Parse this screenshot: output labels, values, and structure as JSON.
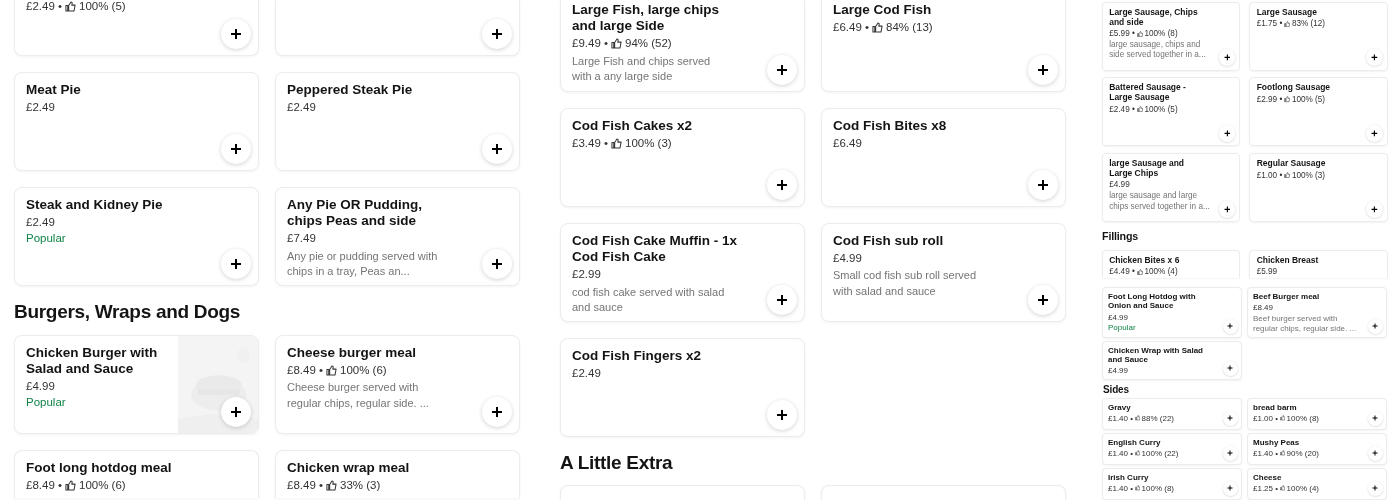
{
  "panels": [
    {
      "blocks": [
        {
          "kind": "cards",
          "items": [
            {
              "kind": "plain",
              "price": "£2.49 •",
              "rating": "100% (5)"
            },
            {
              "kind": "plain"
            }
          ]
        },
        {
          "kind": "cards",
          "items": [
            {
              "kind": "plain",
              "title": "Meat Pie",
              "price": "£2.49"
            },
            {
              "kind": "plain",
              "title": "Peppered Steak Pie",
              "price": "£2.49"
            },
            {
              "kind": "plain",
              "title": "Steak and Kidney Pie",
              "price": "£2.49",
              "popular": "Popular"
            },
            {
              "kind": "plain",
              "title": "Any Pie OR Pudding, chips Peas and side",
              "price": "£7.49",
              "description": "Any pie or pudding served with chips in a tray, Peas an..."
            }
          ]
        },
        {
          "kind": "heading",
          "text": "Burgers, Wraps and Dogs"
        },
        {
          "kind": "cards",
          "items": [
            {
              "kind": "picture",
              "title": "Chicken Burger with Salad and Sauce",
              "price": "£4.99",
              "popular": "Popular"
            },
            {
              "kind": "plain",
              "title": "Cheese burger meal",
              "price": "£8.49 •",
              "rating": "100% (6)",
              "description": "Cheese burger served with regular chips, regular side. ..."
            }
          ]
        },
        {
          "kind": "cards",
          "items": [
            {
              "kind": "plain",
              "title": "Foot long hotdog meal",
              "price": "£8.49 •",
              "rating": "100% (6)"
            },
            {
              "kind": "plain",
              "title": "Chicken wrap meal",
              "price": "£8.49 •",
              "rating": "33% (3)"
            }
          ]
        }
      ]
    },
    {
      "blocks": [
        {
          "kind": "cards",
          "items": [
            {
              "kind": "plain",
              "title": "Large Fish, large chips and large Side",
              "price": "£9.49 •",
              "rating": "94% (52)",
              "description": "Large Fish and chips served with a any large side"
            },
            {
              "kind": "plain",
              "title": "Large Cod Fish",
              "price": "£6.49 •",
              "rating": "84% (13)"
            }
          ]
        },
        {
          "kind": "cards",
          "items": [
            {
              "kind": "plain",
              "title": "Cod Fish Cakes x2",
              "price": "£3.49 •",
              "rating": "100% (3)"
            },
            {
              "kind": "plain",
              "title": "Cod Fish Bites x8",
              "price": "£6.49"
            },
            {
              "kind": "plain",
              "title": "Cod Fish Cake Muffin - 1x Cod Fish Cake",
              "price": "£2.99",
              "description": "cod fish cake served with salad and sauce"
            },
            {
              "kind": "plain",
              "title": "Cod Fish sub roll",
              "price": "£4.99",
              "description": "Small cod fish sub roll served with salad and sauce"
            },
            {
              "kind": "plain",
              "title": "Cod Fish Fingers x2",
              "price": "£2.49"
            }
          ]
        },
        {
          "kind": "heading",
          "text": "A Little Extra"
        },
        {
          "kind": "cards",
          "items": [
            {
              "kind": "plain"
            },
            {
              "kind": "plain"
            }
          ]
        }
      ]
    },
    {
      "blocks": [
        {
          "kind": "cards",
          "items": [
            {
              "kind": "plain",
              "title": "Large Sausage, Chips and side",
              "price": "£5.99 •",
              "rating": "100% (8)",
              "description": "large sausage, chips and side served together in a..."
            },
            {
              "kind": "plain",
              "title": "Large Sausage",
              "price": "£1.75 •",
              "rating": "83% (12)"
            },
            {
              "kind": "plain",
              "title": "Battered Sausage - Large Sausage",
              "price": "£2.49 •",
              "rating": "100% (5)"
            },
            {
              "kind": "plain",
              "title": "Footlong Sausage",
              "price": "£2.99 •",
              "rating": "100% (5)"
            },
            {
              "kind": "plain",
              "title": "large Sausage and Large Chips",
              "price": "£4.99",
              "description": "large sausage and large chips served together in a..."
            },
            {
              "kind": "plain",
              "title": "Regular Sausage",
              "price": "£1.00 •",
              "rating": "100% (3)"
            }
          ]
        },
        {
          "kind": "heading",
          "text": "Fillings"
        },
        {
          "kind": "cards",
          "items": [
            {
              "kind": "plain",
              "title": "Chicken Bites x 6",
              "price": "£4.49 •",
              "rating": "100% (4)"
            },
            {
              "kind": "plain",
              "title": "Chicken Breast",
              "price": "£5.99"
            }
          ]
        }
      ]
    },
    {
      "blocks": [
        {
          "kind": "cards",
          "items": [
            {
              "kind": "plain",
              "title": "Foot Long Hotdog with Onion and Sauce",
              "price": "£4.99",
              "popular": "Popular"
            },
            {
              "kind": "plain",
              "title": "Beef Burger meal",
              "price": "£8.49",
              "description": "Beef burger served with regular chips, regular side. ..."
            },
            {
              "kind": "plain",
              "title": "Chicken Wrap with Salad and Sauce",
              "price": "£4.99"
            }
          ]
        },
        {
          "kind": "heading",
          "text": "Sides"
        },
        {
          "kind": "cards",
          "items": [
            {
              "kind": "plain",
              "title": "Gravy",
              "price": "£1.40 •",
              "rating": "88% (22)"
            },
            {
              "kind": "plain",
              "title": "bread barm",
              "price": "£1.00 •",
              "rating": "100% (8)"
            },
            {
              "kind": "plain",
              "title": "English Curry",
              "price": "£1.40 •",
              "rating": "100% (22)"
            },
            {
              "kind": "plain",
              "title": "Mushy Peas",
              "price": "£1.40 •",
              "rating": "90% (20)"
            }
          ]
        },
        {
          "kind": "cards",
          "items": [
            {
              "kind": "plain",
              "title": "Irish Curry",
              "price": "£1.40 •",
              "rating": "100% (8)"
            },
            {
              "kind": "plain",
              "title": "Cheese",
              "price": "£1.25 •",
              "rating": "100% (4)"
            }
          ]
        }
      ]
    }
  ]
}
